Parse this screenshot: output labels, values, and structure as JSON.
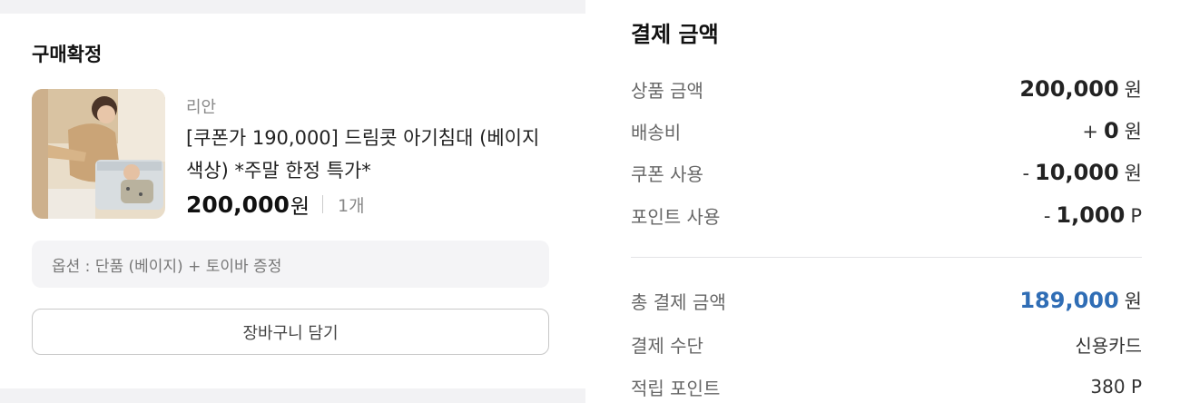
{
  "order": {
    "section_title": "구매확정",
    "brand": "리안",
    "product_name": "[쿠폰가 190,000] 드림콧 아기침대 (베이지 색상) *주말 한정 특가*",
    "price": "200,000",
    "price_unit": "원",
    "quantity": "1개",
    "option": "옵션 : 단품 (베이지) + 토이바 증정",
    "cart_button": "장바구니 담기"
  },
  "payment": {
    "title": "결제 금액",
    "rows": [
      {
        "label": "상품 금액",
        "sign": "",
        "amount": "200,000",
        "unit": "원"
      },
      {
        "label": "배송비",
        "sign": "+",
        "amount": "0",
        "unit": "원"
      },
      {
        "label": "쿠폰 사용",
        "sign": "-",
        "amount": "10,000",
        "unit": "원"
      },
      {
        "label": "포인트 사용",
        "sign": "-",
        "amount": "1,000",
        "unit": "P"
      }
    ],
    "total": {
      "label": "총 결제 금액",
      "amount": "189,000",
      "unit": "원"
    },
    "method": {
      "label": "결제 수단",
      "value": "신용카드"
    },
    "points": {
      "label": "적립 포인트",
      "value": "380 P"
    }
  },
  "colors": {
    "accent": "#2f6db5",
    "panel_gray": "#f2f2f4",
    "option_bg": "#f4f4f6"
  },
  "icons": {
    "product_image": "product-photo-baby-crib"
  }
}
